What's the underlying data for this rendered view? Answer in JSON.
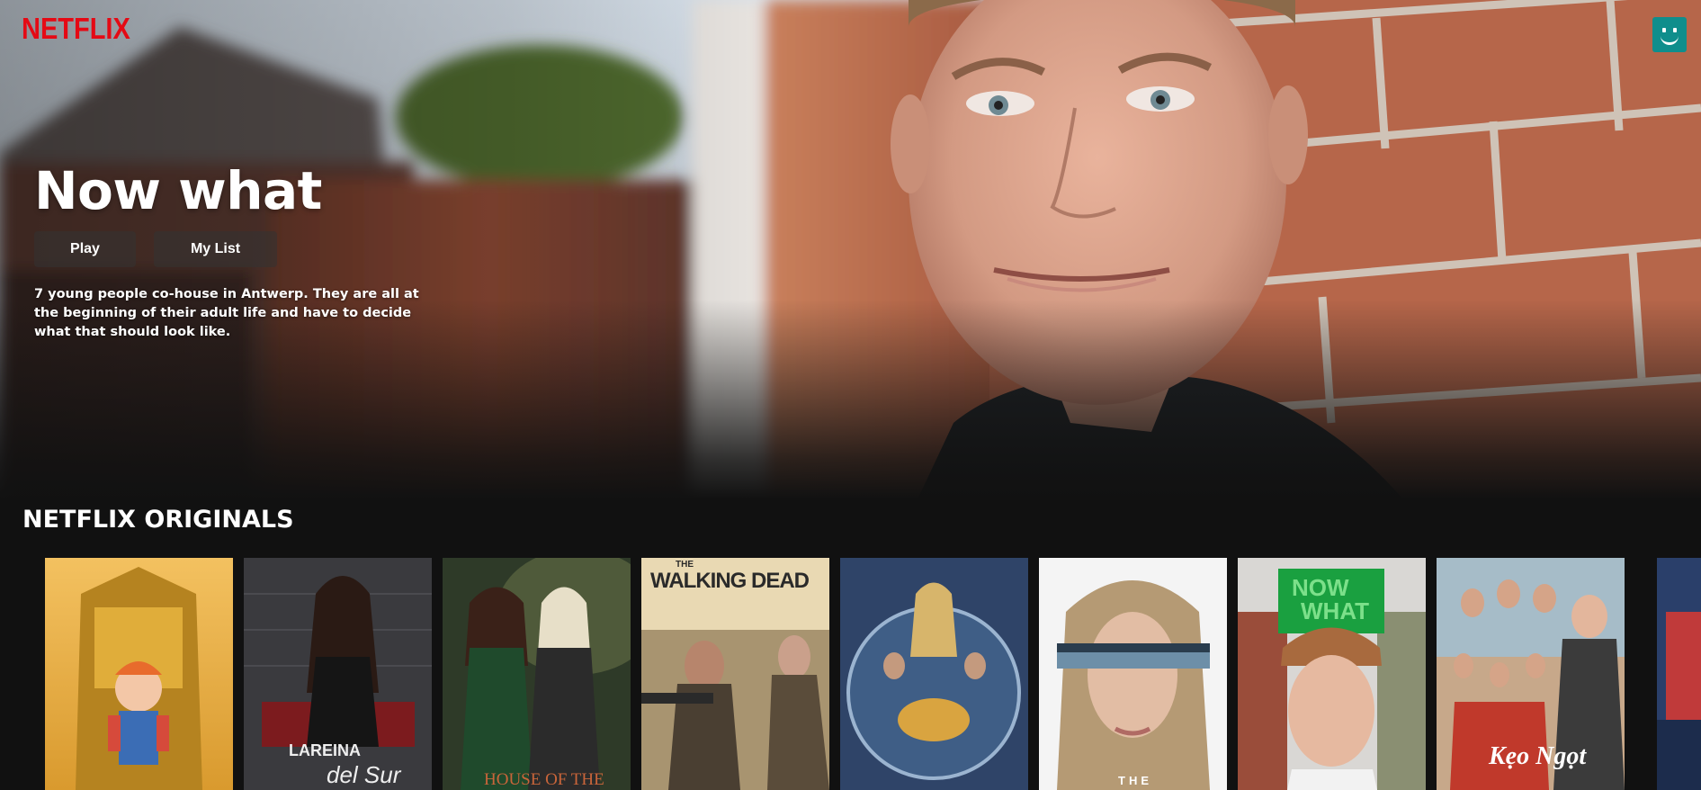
{
  "app": {
    "brand": "NETFLIX"
  },
  "header": {
    "profile_icon": "smiley-profile-icon",
    "profile_color": "#0f8e8c"
  },
  "hero": {
    "title": "Now what",
    "play_label": "Play",
    "mylist_label": "My List",
    "description": "7 young people co-house in Antwerp. They are all at the beginning of their adult life and have to decide what that should look like."
  },
  "row": {
    "title": "NETFLIX ORIGINALS",
    "posters": [
      {
        "name": "chucky"
      },
      {
        "name": "la-reina-del-sur",
        "text_a": "LA",
        "text_b": "REINA",
        "text_c": "del Sur"
      },
      {
        "name": "house-of-the-dragon",
        "text": "HOUSE OF THE"
      },
      {
        "name": "the-walking-dead",
        "text_a": "THE",
        "text_b": "WALKING DEAD"
      },
      {
        "name": "rings-of-power"
      },
      {
        "name": "the-peripheral",
        "text": "THE"
      },
      {
        "name": "now-what",
        "text_a": "NOW",
        "text_b": "WHAT"
      },
      {
        "name": "ky-poster",
        "text": "Kẹo Ngọt"
      },
      {
        "name": "partial-poster"
      }
    ]
  },
  "colors": {
    "brand_red": "#e50914",
    "background": "#111111",
    "now_what_green": "#1aa040"
  }
}
